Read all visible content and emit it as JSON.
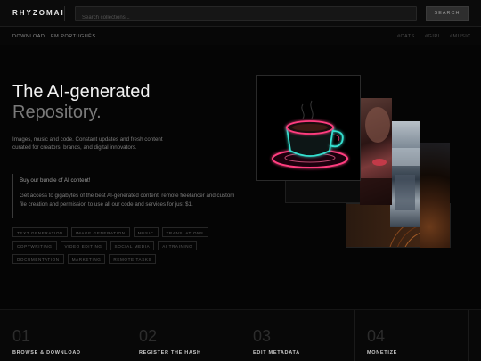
{
  "header": {
    "logo": "RHYZOMAI",
    "search_placeholder": "Search collections...",
    "search_button": "SEARCH"
  },
  "subnav": {
    "left": [
      "DOWNLOAD",
      "EM PORTUGUÊS"
    ],
    "right": [
      "#CATS",
      "#GIRL",
      "#MUSIC"
    ]
  },
  "hero": {
    "title_line1": "The AI-generated",
    "title_line2": "Repository.",
    "description": "Images, music and code. Constant updates and fresh content curated for creators, brands, and digital innovators.",
    "callout_title": "Buy our bundle of AI content!",
    "callout_body": "Get access to gigabytes of the best AI-generated content, remote freelancer and custom file creation and permission to use all our code and services for just $1."
  },
  "tags": [
    "TEXT GENERATION",
    "IMAGE GENERATION",
    "MUSIC",
    "TRANSLATIONS",
    "COPYWRITING",
    "VIDEO EDITING",
    "SOCIAL MEDIA",
    "AI TRAINING",
    "DOCUMENTATION",
    "MARKETING",
    "REMOTE TASKS"
  ],
  "steps": [
    {
      "num": "01",
      "label": "BROWSE & DOWNLOAD"
    },
    {
      "num": "02",
      "label": "REGISTER THE HASH"
    },
    {
      "num": "03",
      "label": "EDIT METADATA"
    },
    {
      "num": "04",
      "label": "MONETIZE"
    }
  ],
  "colors": {
    "background": "#050505",
    "neon_pink": "#ff3d7f",
    "neon_teal": "#35e0d0"
  },
  "icons": [
    "neon-coffee-cup-image",
    "woman-face-image",
    "portrait-image",
    "vinyl-record-image"
  ]
}
